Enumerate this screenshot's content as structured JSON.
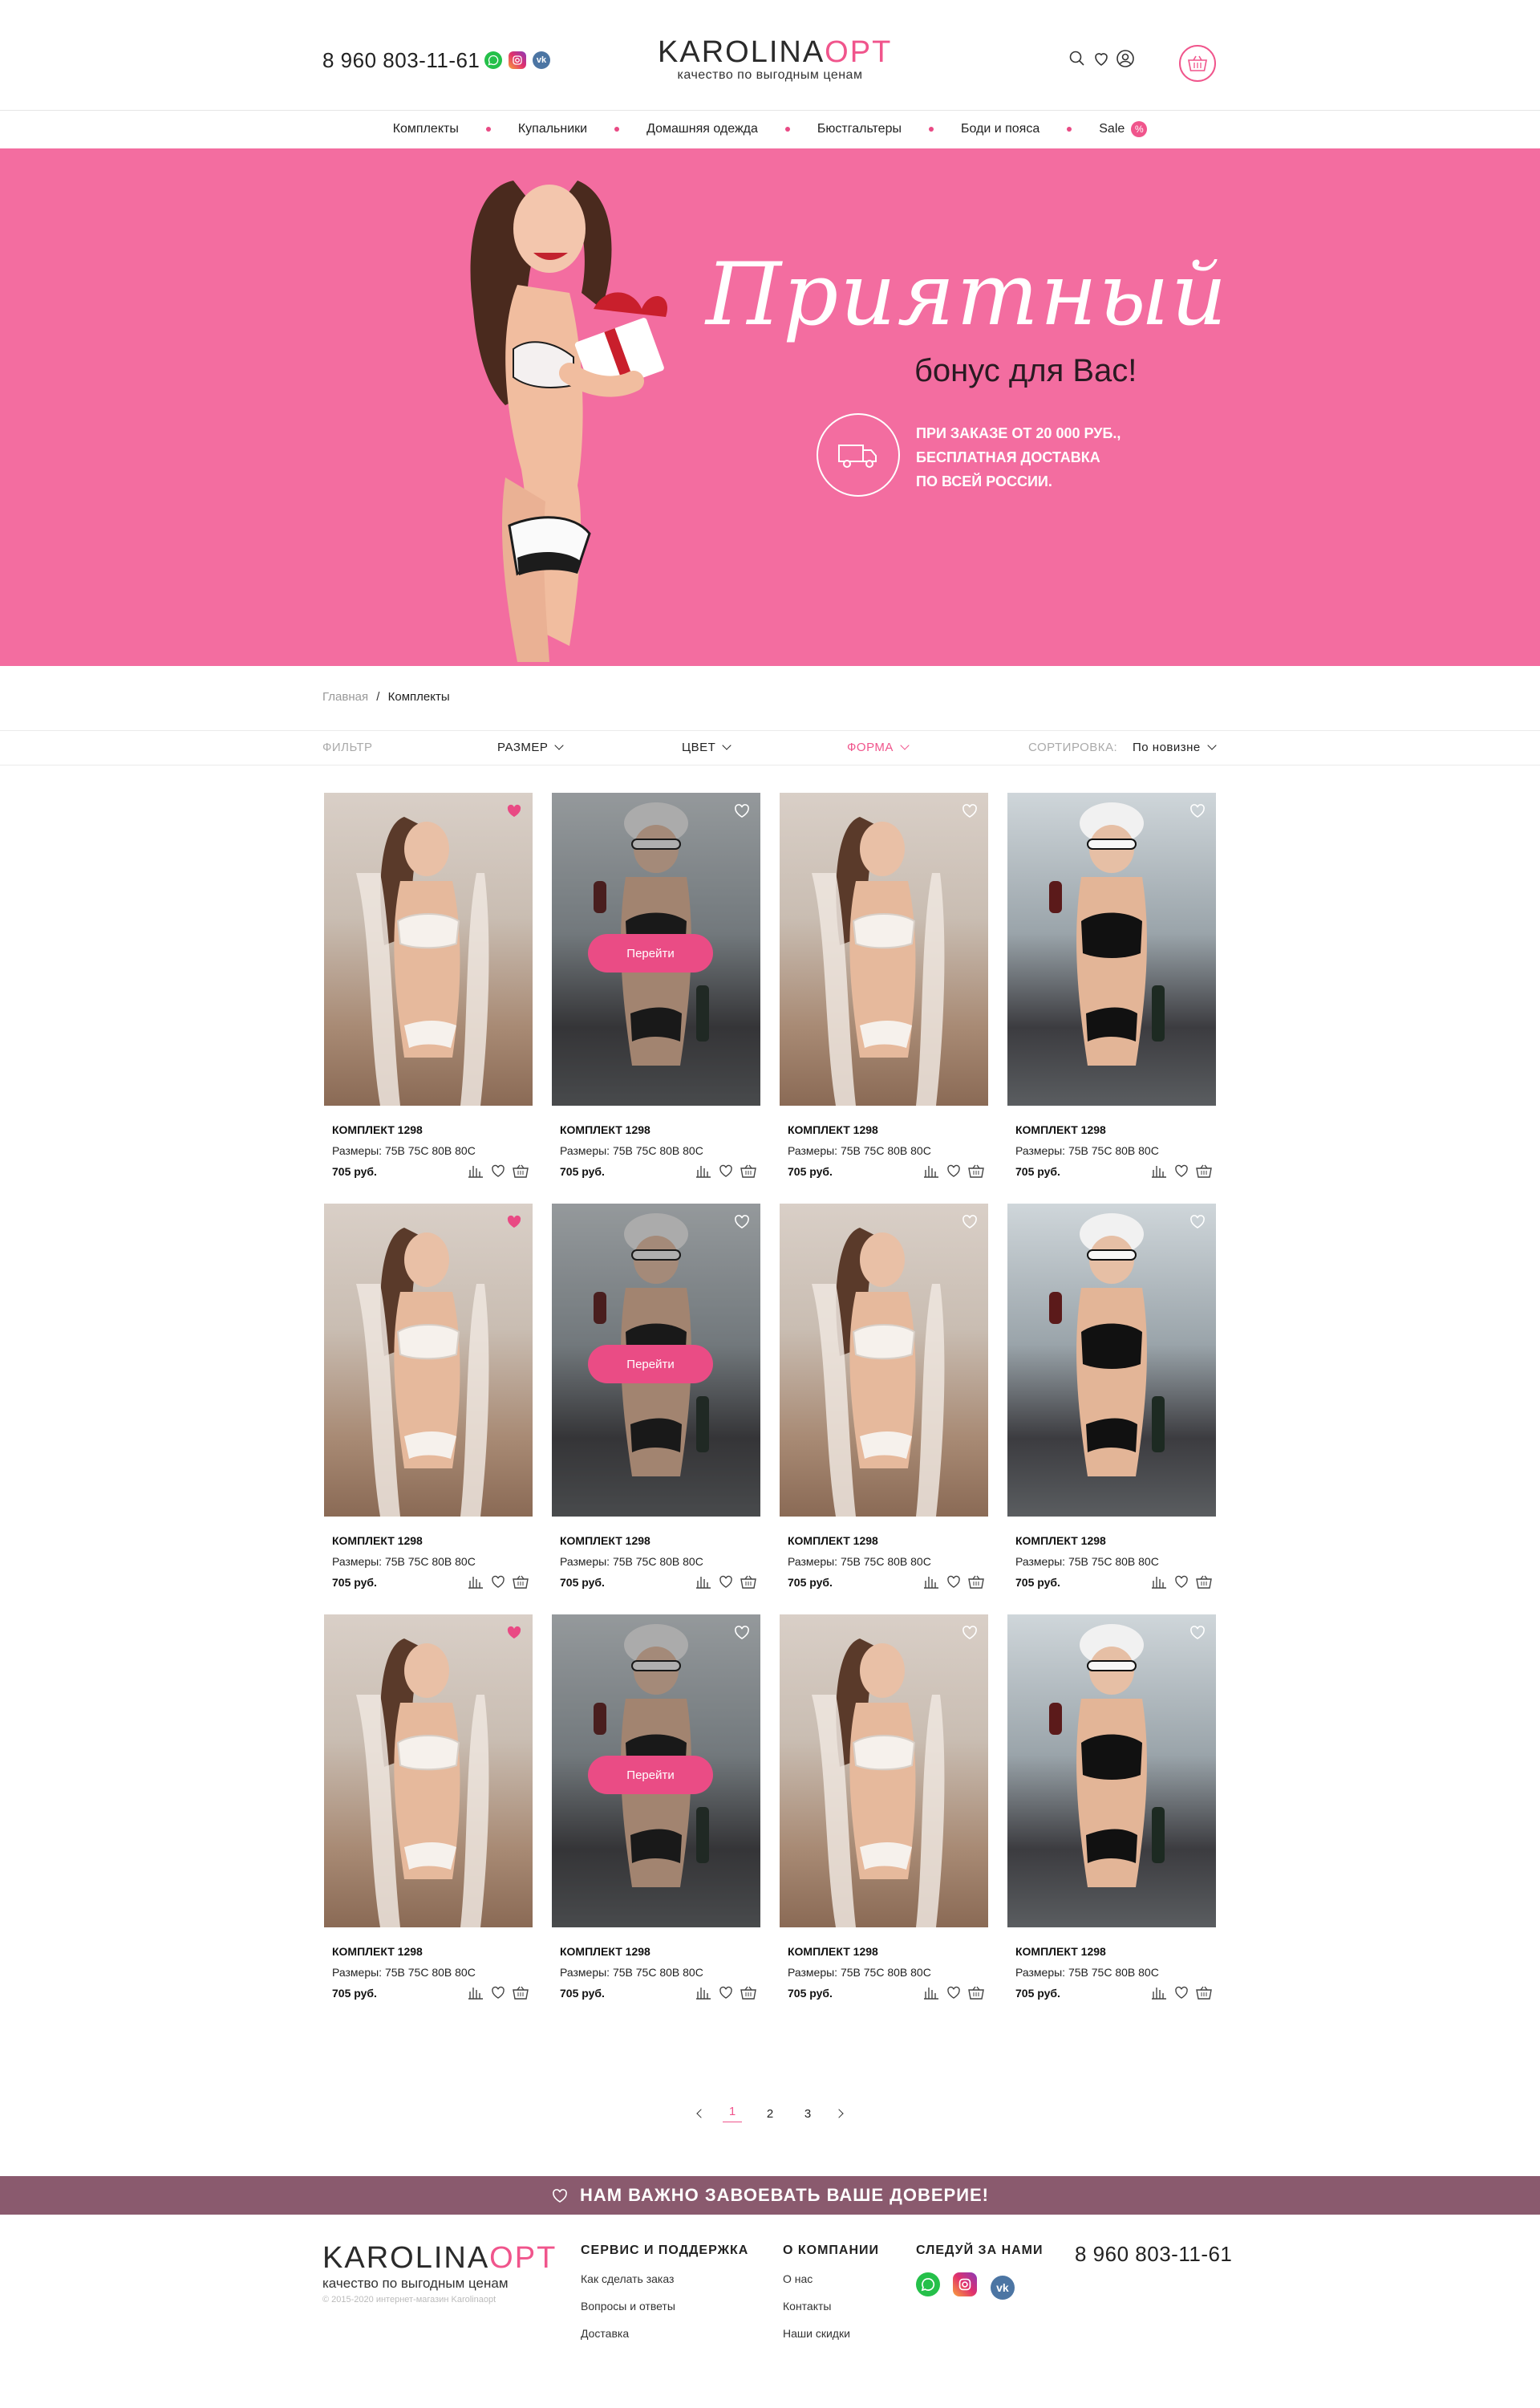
{
  "header": {
    "phone": "8 960 803-11-61",
    "logo_main": "KAROLINA",
    "logo_accent": "OPT",
    "logo_sub": "качество по выгодным ценам"
  },
  "nav": {
    "items": [
      "Комплекты",
      "Купальники",
      "Домашняя одежда",
      "Бюстгальтеры",
      "Боди и пояса"
    ],
    "sale_label": "Sale",
    "sale_badge": "%"
  },
  "hero": {
    "script_title": "Приятный",
    "subtitle": "бонус для Вас!",
    "delivery_line1": "При заказе от 20 000 руб.,",
    "delivery_line2": "бесплатная доставка",
    "delivery_line3": "по всей России."
  },
  "breadcrumb": {
    "home": "Главная",
    "separator": "/",
    "current": "Комплекты"
  },
  "filter": {
    "label": "ФИЛЬТР",
    "size": "РАЗМЕР",
    "color": "ЦВЕТ",
    "shape": "ФОРМА",
    "sort_label": "СОРТИРОВКА:",
    "sort_value": "По новизне"
  },
  "product": {
    "name": "КОМПЛЕКТ 1298",
    "sizes_label": "Размеры:",
    "sizes": "75B 75C 80B 80C",
    "price": "705 руб.",
    "goto_label": "Перейти"
  },
  "pagination": {
    "pages": [
      "1",
      "2",
      "3"
    ],
    "active": "1"
  },
  "trust": {
    "text": "НАМ ВАЖНО ЗАВОЕВАТЬ ВАШЕ ДОВЕРИЕ!"
  },
  "footer": {
    "logo_main": "KAROLINA",
    "logo_accent": "OPT",
    "logo_sub": "качество по выгодным ценам",
    "copyright": "© 2015-2020 интернет-магазин Karolinaopt",
    "service_title": "СЕРВИС И ПОДДЕРЖКА",
    "service_links": [
      "Как сделать заказ",
      "Вопросы и ответы",
      "Доставка"
    ],
    "company_title": "О КОМПАНИИ",
    "company_links": [
      "О нас",
      "Контакты",
      "Наши скидки"
    ],
    "follow_title": "СЛЕДУЙ ЗА НАМИ",
    "phone": "8 960 803-11-61"
  },
  "colors": {
    "accent": "#f0558c",
    "hero_bg": "#f36da0",
    "trust_bg": "#8a5a6e"
  },
  "icons": [
    "whatsapp-icon",
    "instagram-icon",
    "vk-icon",
    "search-icon",
    "heart-icon",
    "user-icon",
    "basket-icon",
    "truck-icon",
    "compare-icon"
  ]
}
